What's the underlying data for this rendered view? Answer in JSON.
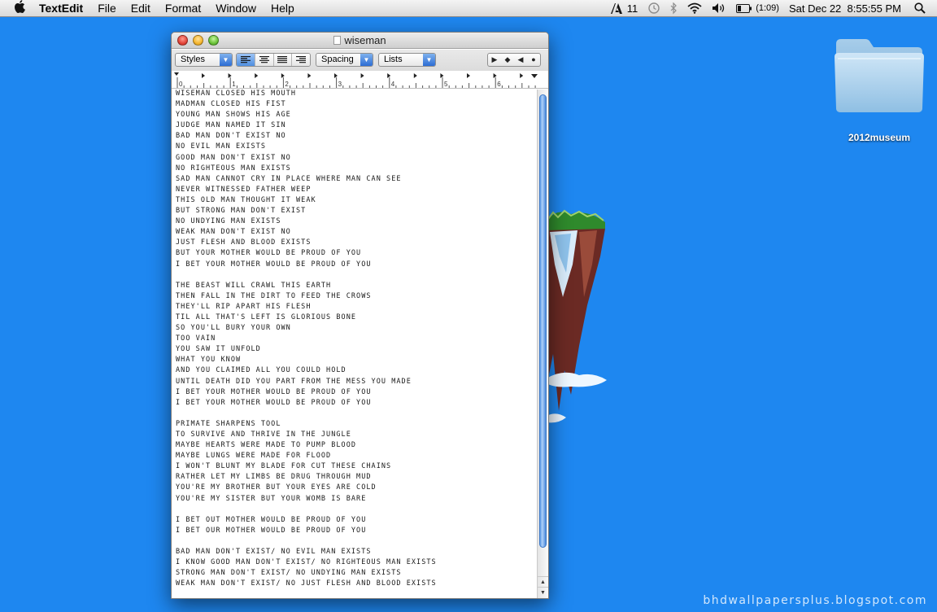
{
  "menubar": {
    "apple_icon": "apple-logo-icon",
    "app_name": "TextEdit",
    "menus": [
      "File",
      "Edit",
      "Format",
      "Window",
      "Help"
    ],
    "status": {
      "adobe_count": "11",
      "battery_time": "(1:09)",
      "datetime": "Sat Dec 22  8:55:55 PM"
    }
  },
  "desktop": {
    "folder_label": "2012museum",
    "watermark": "bhdwallpapersplus.blogspot.com",
    "background_color": "#1e87f0"
  },
  "window": {
    "title": "wiseman",
    "toolbar": {
      "styles_label": "Styles",
      "spacing_label": "Spacing",
      "lists_label": "Lists"
    },
    "ruler_marks": [
      "0",
      "1",
      "2",
      "3",
      "4",
      "5",
      "6"
    ],
    "text": "WISEMAN CLOSED HIS MOUTH\nMADMAN CLOSED HIS FIST\nYOUNG MAN SHOWS HIS AGE\nJUDGE MAN NAMED IT SIN\nBAD MAN DON'T EXIST NO\nNO EVIL MAN EXISTS\nGOOD MAN DON'T EXIST NO\nNO RIGHTEOUS MAN EXISTS\nSAD MAN CANNOT CRY IN PLACE WHERE MAN CAN SEE\nNEVER WITNESSED FATHER WEEP\nTHIS OLD MAN THOUGHT IT WEAK\nBUT STRONG MAN DON'T EXIST\nNO UNDYING MAN EXISTS\nWEAK MAN DON'T EXIST NO\nJUST FLESH AND BLOOD EXISTS\nBUT YOUR MOTHER WOULD BE PROUD OF YOU\nI BET YOUR MOTHER WOULD BE PROUD OF YOU\n\nTHE BEAST WILL CRAWL THIS EARTH\nTHEN FALL IN THE DIRT TO FEED THE CROWS\nTHEY'LL RIP APART HIS FLESH\nTIL ALL THAT'S LEFT IS GLORIOUS BONE\nSO YOU'LL BURY YOUR OWN\nTOO VAIN\nYOU SAW IT UNFOLD\nWHAT YOU KNOW\nAND YOU CLAIMED ALL YOU COULD HOLD\nUNTIL DEATH DID YOU PART FROM THE MESS YOU MADE\nI BET YOUR MOTHER WOULD BE PROUD OF YOU\nI BET YOUR MOTHER WOULD BE PROUD OF YOU\n\nPRIMATE SHARPENS TOOL\nTO SURVIVE AND THRIVE IN THE JUNGLE\nMAYBE HEARTS WERE MADE TO PUMP BLOOD\nMAYBE LUNGS WERE MADE FOR FLOOD\nI WON'T BLUNT MY BLADE FOR CUT THESE CHAINS\nRATHER LET MY LIMBS BE DRUG THROUGH MUD\nYOU'RE MY BROTHER BUT YOUR EYES ARE COLD\nYOU'RE MY SISTER BUT YOUR WOMB IS BARE\n\nI BET OUT MOTHER WOULD BE PROUD OF YOU\nI BET OUR MOTHER WOULD BE PROUD OF YOU\n\nBAD MAN DON'T EXIST/ NO EVIL MAN EXISTS\nI KNOW GOOD MAN DON'T EXIST/ NO RIGHTEOUS MAN EXISTS\nSTRONG MAN DON'T EXIST/ NO UNDYING MAN EXISTS\nWEAK MAN DON'T EXIST/ NO JUST FLESH AND BLOOD EXISTS"
  }
}
